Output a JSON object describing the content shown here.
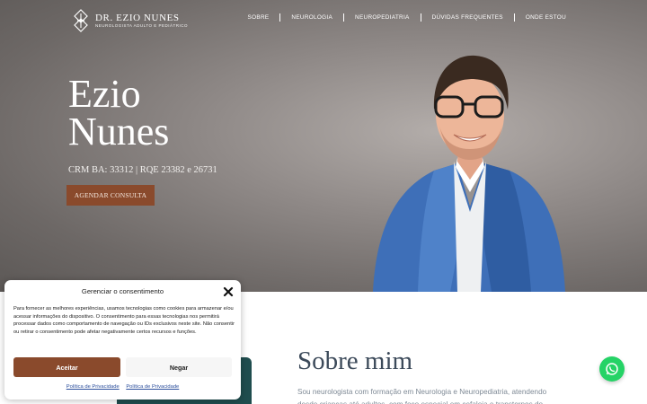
{
  "header": {
    "logo_title": "DR. EZIO NUNES",
    "logo_subtitle": "NEUROLOGISTA ADULTO E PEDIÁTRICO",
    "nav": [
      "SOBRE",
      "NEUROLOGIA",
      "NEUROPEDIATRIA",
      "DÚVIDAS FREQUENTES",
      "ONDE ESTOU"
    ]
  },
  "hero": {
    "title_line1": "Ezio",
    "title_line2": "Nunes",
    "credentials": "CRM BA: 33312 | RQE 23382 e 26731",
    "cta_label": "AGENDAR CONSULTA"
  },
  "about": {
    "title": "Sobre mim",
    "text": "Sou neurologista com formação em Neurologia e Neuropediatria, atendendo desde crianças até adultos, com foco especial em cefaleia e transtornos do"
  },
  "consent": {
    "title": "Gerenciar o consentimento",
    "body": "Para fornecer as melhores experiências, usamos tecnologias como cookies para armazenar e/ou acessar informações do dispositivo. O consentimento para essas tecnologias nos permitirá processar dados como comportamento de navegação ou IDs exclusivos neste site. Não consentir ou retirar o consentimento pode afetar negativamente certos recursos e funções.",
    "accept_label": "Aceitar",
    "deny_label": "Negar",
    "link1": "Política de Privacidade",
    "link2": "Política de Privacidade"
  },
  "colors": {
    "accent": "#8a4a2c",
    "whatsapp": "#25d366",
    "heading": "#3c4a5a"
  },
  "icons": {
    "logo": "logo-mark-icon",
    "close": "close-icon",
    "whatsapp": "whatsapp-icon"
  }
}
